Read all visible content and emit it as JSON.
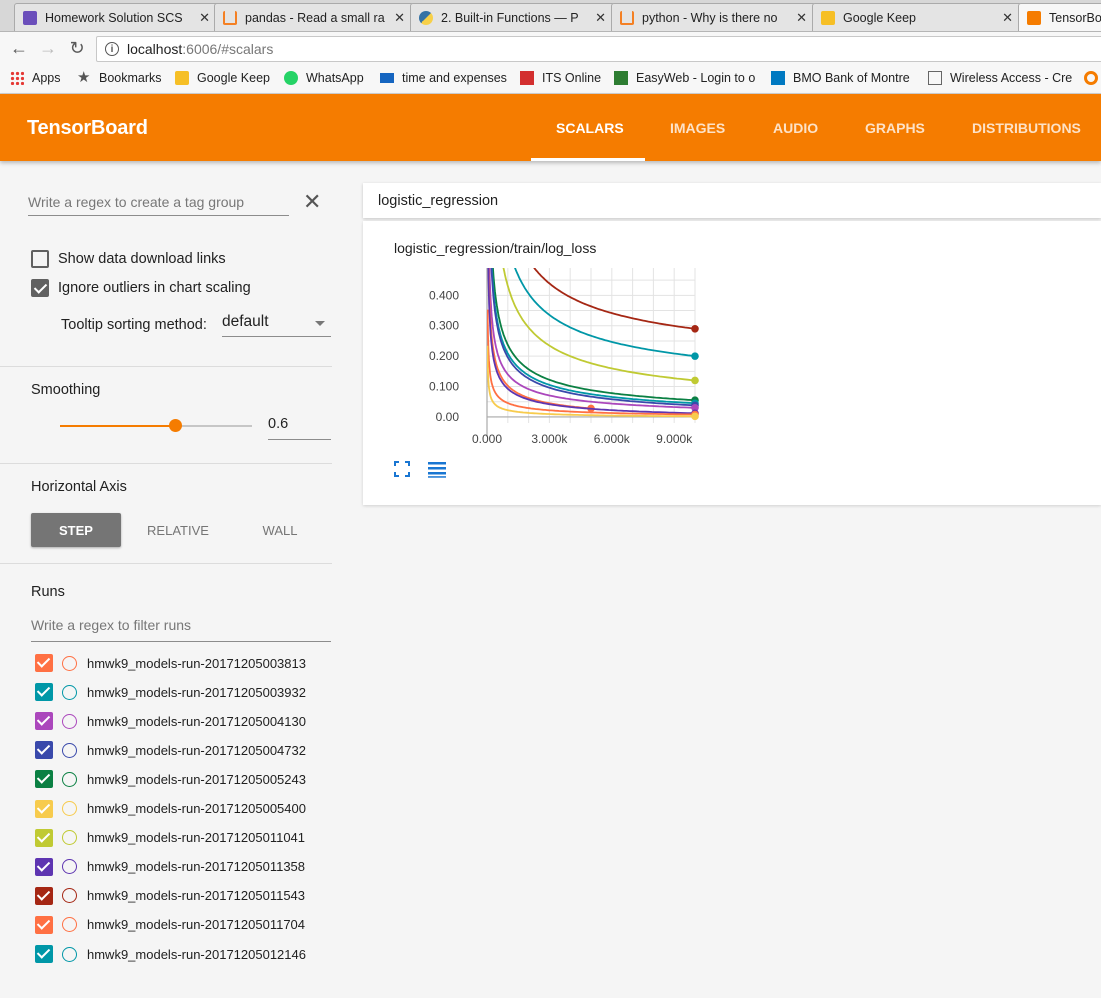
{
  "browser": {
    "tabs": [
      {
        "title": "Homework Solution SCS",
        "icon": "form-icon",
        "color": "#6b4fbb"
      },
      {
        "title": "pandas - Read a small ra",
        "icon": "stackoverflow-icon",
        "color": "#f48024"
      },
      {
        "title": "2. Built-in Functions — P",
        "icon": "python-icon",
        "color": "#3572a5"
      },
      {
        "title": "python - Why is there no",
        "icon": "stackoverflow-icon",
        "color": "#f48024"
      },
      {
        "title": "Google Keep",
        "icon": "keep-icon",
        "color": "#f6bf26"
      },
      {
        "title": "TensorBo",
        "icon": "tensorboard-icon",
        "color": "#f57c00"
      }
    ],
    "url_host": "localhost",
    "url_path": ":6006/#scalars",
    "bookmarks": [
      {
        "label": "Apps",
        "icon": "apps-grid-icon"
      },
      {
        "label": "Bookmarks",
        "icon": "star-icon"
      },
      {
        "label": "Google Keep",
        "icon": "keep-icon"
      },
      {
        "label": "WhatsApp",
        "icon": "whatsapp-icon"
      },
      {
        "label": "time and expenses",
        "icon": "sap-icon"
      },
      {
        "label": "ITS Online",
        "icon": "now-icon"
      },
      {
        "label": "EasyWeb - Login to o",
        "icon": "td-icon"
      },
      {
        "label": "BMO Bank of Montre",
        "icon": "bmo-icon"
      },
      {
        "label": "Wireless Access - Cre",
        "icon": "page-icon"
      }
    ]
  },
  "header": {
    "title": "TensorBoard",
    "tabs": [
      "SCALARS",
      "IMAGES",
      "AUDIO",
      "GRAPHS",
      "DISTRIBUTIONS"
    ],
    "active_tab": "SCALARS"
  },
  "sidebar": {
    "tag_regex_placeholder": "Write a regex to create a tag group",
    "show_download_links": {
      "label": "Show data download links",
      "checked": false
    },
    "ignore_outliers": {
      "label": "Ignore outliers in chart scaling",
      "checked": true
    },
    "tooltip_label": "Tooltip sorting method:",
    "tooltip_value": "default",
    "smoothing_title": "Smoothing",
    "smoothing_value": "0.6",
    "smoothing_fraction": 0.6,
    "horizontal_axis_title": "Horizontal Axis",
    "axis_options": [
      "STEP",
      "RELATIVE",
      "WALL"
    ],
    "axis_selected": "STEP",
    "runs_title": "Runs",
    "runs_filter_placeholder": "Write a regex to filter runs",
    "runs": [
      {
        "name": "hmwk9_models-run-20171205003813",
        "color": "#ff7043",
        "checked": true
      },
      {
        "name": "hmwk9_models-run-20171205003932",
        "color": "#0097a7",
        "checked": true
      },
      {
        "name": "hmwk9_models-run-20171205004130",
        "color": "#ab47bc",
        "checked": true
      },
      {
        "name": "hmwk9_models-run-20171205004732",
        "color": "#3949ab",
        "checked": true
      },
      {
        "name": "hmwk9_models-run-20171205005243",
        "color": "#0b8043",
        "checked": true
      },
      {
        "name": "hmwk9_models-run-20171205005400",
        "color": "#f7cb4d",
        "checked": true
      },
      {
        "name": "hmwk9_models-run-20171205011041",
        "color": "#c0ca33",
        "checked": true
      },
      {
        "name": "hmwk9_models-run-20171205011358",
        "color": "#5e35b1",
        "checked": true
      },
      {
        "name": "hmwk9_models-run-20171205011543",
        "color": "#a52714",
        "checked": true
      },
      {
        "name": "hmwk9_models-run-20171205011704",
        "color": "#ff7043",
        "checked": true
      },
      {
        "name": "hmwk9_models-run-20171205012146",
        "color": "#0097a7",
        "checked": true
      }
    ]
  },
  "main": {
    "group_title": "logistic_regression",
    "card_title": "logistic_regression/train/log_loss"
  },
  "chart_data": {
    "type": "line",
    "title": "logistic_regression/train/log_loss",
    "xlabel": "",
    "ylabel": "",
    "xlim": [
      0,
      10000
    ],
    "ylim": [
      -0.02,
      0.49
    ],
    "x_ticks": [
      0,
      3000,
      6000,
      9000
    ],
    "x_tick_labels": [
      "0.000",
      "3.000k",
      "6.000k",
      "9.000k"
    ],
    "y_ticks": [
      0,
      0.1,
      0.2,
      0.3,
      0.4
    ],
    "y_tick_labels": [
      "0.00",
      "0.100",
      "0.200",
      "0.300",
      "0.400"
    ],
    "grid": true,
    "series": [
      {
        "color": "#a52714",
        "start_x": 1200,
        "end_x": 10000,
        "final": 0.29,
        "k": 0.17
      },
      {
        "color": "#0097a7",
        "start_x": 500,
        "end_x": 10000,
        "final": 0.2,
        "k": 0.25
      },
      {
        "color": "#c0ca33",
        "start_x": 300,
        "end_x": 10000,
        "final": 0.12,
        "k": 0.28
      },
      {
        "color": "#0b8043",
        "start_x": 100,
        "end_x": 10000,
        "final": 0.055,
        "k": 0.3
      },
      {
        "color": "#0097a7",
        "start_x": 100,
        "end_x": 10000,
        "final": 0.045,
        "k": 0.27
      },
      {
        "color": "#3949ab",
        "start_x": 100,
        "end_x": 10000,
        "final": 0.038,
        "k": 0.26
      },
      {
        "color": "#ab47bc",
        "start_x": 60,
        "end_x": 10000,
        "final": 0.03,
        "k": 0.24
      },
      {
        "color": "#ff7043",
        "start_x": 50,
        "end_x": 5000,
        "final": 0.028,
        "k": 0.22
      },
      {
        "color": "#5e35b1",
        "start_x": 40,
        "end_x": 10000,
        "final": 0.012,
        "k": 0.22
      },
      {
        "color": "#ff7043",
        "start_x": 30,
        "end_x": 10000,
        "final": 0.008,
        "k": 0.12
      },
      {
        "color": "#f7cb4d",
        "start_x": 20,
        "end_x": 10000,
        "final": 0.002,
        "k": 0.08
      }
    ]
  }
}
